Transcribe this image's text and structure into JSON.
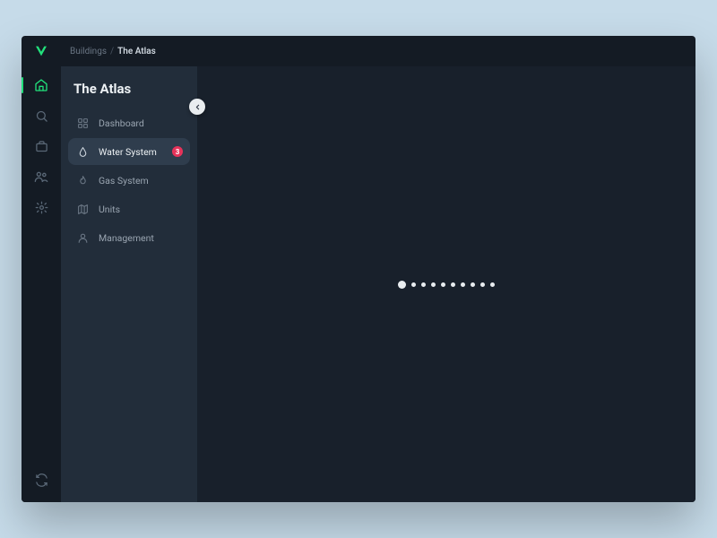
{
  "breadcrumb": {
    "parent": "Buildings",
    "separator": "/",
    "current": "The Atlas"
  },
  "sidebar": {
    "title": "The Atlas",
    "items": [
      {
        "label": "Dashboard"
      },
      {
        "label": "Water System",
        "badge": "3"
      },
      {
        "label": "Gas System"
      },
      {
        "label": "Units"
      },
      {
        "label": "Management"
      }
    ]
  },
  "colors": {
    "accent": "#22e07b",
    "danger": "#e6335a",
    "bg_outer": "#c6dbe9",
    "bg_app": "#141b24",
    "bg_sidebar": "#222d3a",
    "bg_main": "#18202b"
  },
  "loading": {
    "dot_count": 10
  }
}
